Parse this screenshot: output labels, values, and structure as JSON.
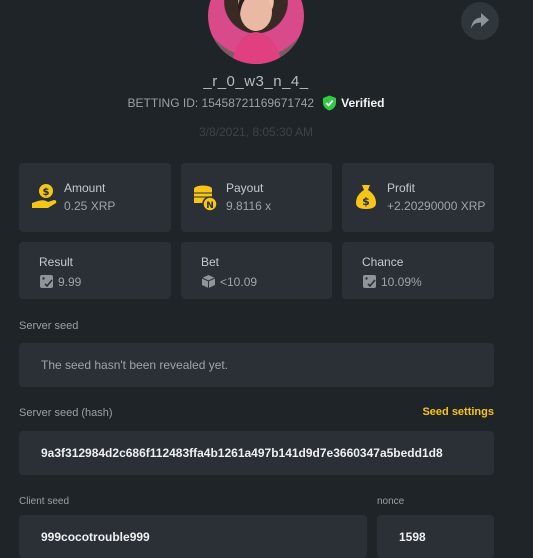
{
  "profile": {
    "username": "_r_0_w3_n_4_",
    "bet_id": "BETTING ID: 15458721169671742",
    "verified_label": "Verified",
    "timestamp": "3/8/2021, 8:05:30 AM"
  },
  "stats": {
    "amount": {
      "label": "Amount",
      "value": "0.25 XRP",
      "icon": "money-bag-coin-icon"
    },
    "payout": {
      "label": "Payout",
      "value": "9.8116 x",
      "icon": "coin-stack-icon"
    },
    "profit": {
      "label": "Profit",
      "value": "+2.20290000 XRP",
      "icon": "money-sack-icon"
    },
    "result": {
      "label": "Result",
      "value": "9.99",
      "icon": "dice-check-icon"
    },
    "bet": {
      "label": "Bet",
      "value": "<10.09",
      "icon": "dice-icon"
    },
    "chance": {
      "label": "Chance",
      "value": "10.09%",
      "icon": "dice-check-icon"
    }
  },
  "server_seed": {
    "label": "Server seed",
    "value": "The seed hasn't been revealed yet."
  },
  "server_seed_hash": {
    "label": "Server seed (hash)",
    "settings_label": "Seed settings",
    "value": "9a3f312984d2c686f112483ffa4b1261a497b141d9d7e3660347a5bedd1d8"
  },
  "client_seed": {
    "label": "Client seed",
    "value": "999cocotrouble999"
  },
  "nonce": {
    "label": "nonce",
    "value": "1598"
  },
  "colors": {
    "background": "#1f2428",
    "card": "#2a3036",
    "accent_yellow": "#f5c518",
    "verified_green": "#2ecc40"
  }
}
